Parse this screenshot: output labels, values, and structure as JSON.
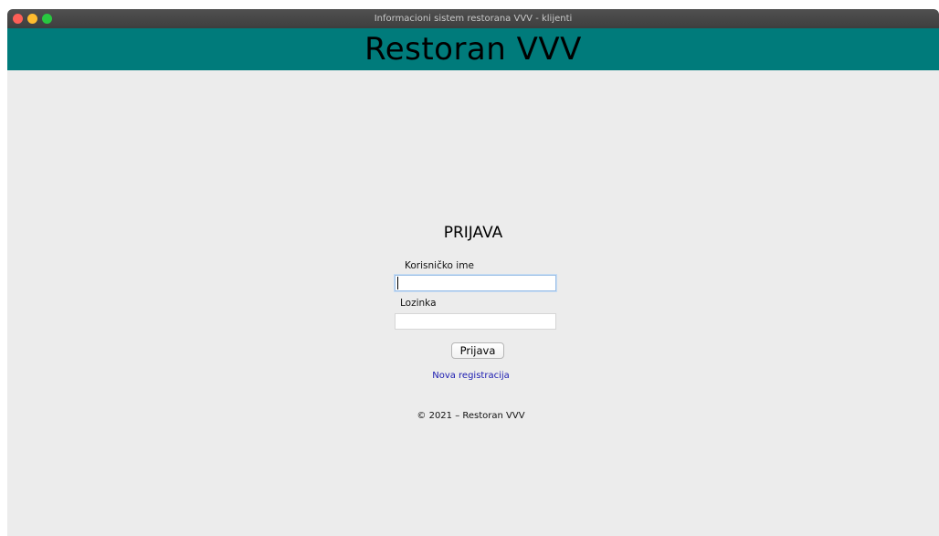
{
  "window": {
    "title": "Informacioni sistem restorana VVV - klijenti"
  },
  "header": {
    "title": "Restoran VVV",
    "background": "#007b7b"
  },
  "login": {
    "heading": "PRIJAVA",
    "username_label": "Korisničko ime",
    "username_value": "",
    "password_label": "Lozinka",
    "password_value": "",
    "submit_label": "Prijava",
    "register_link": "Nova registracija"
  },
  "footer": {
    "copyright": "© 2021 – Restoran VVV"
  },
  "colors": {
    "link": "#1a1ab0",
    "window_bg": "#ececec"
  }
}
